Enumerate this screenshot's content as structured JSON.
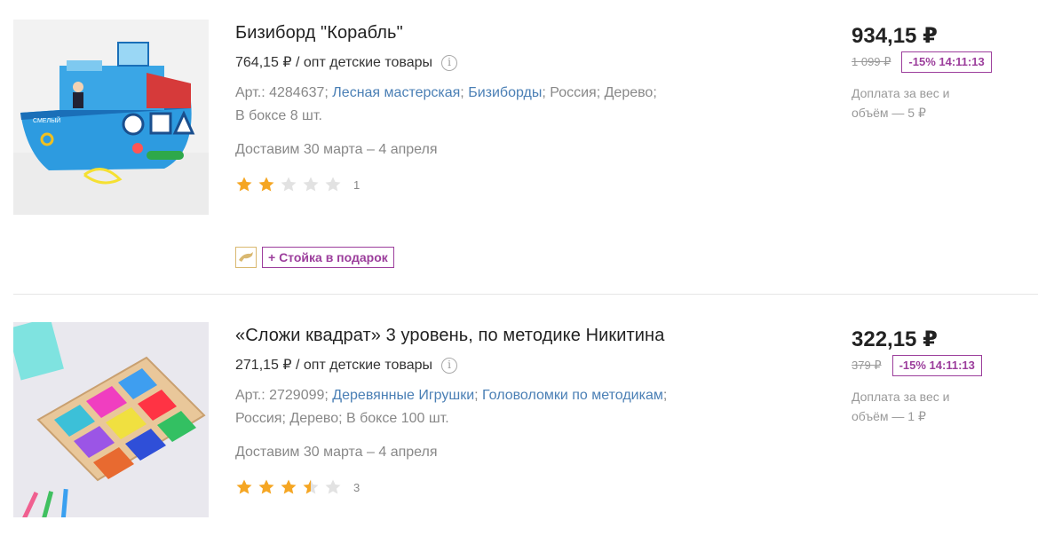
{
  "products": [
    {
      "title": "Бизиборд \"Корабль\"",
      "wholesale_price": "764,15 ₽ / опт детские товары",
      "article": "Арт.: 4284637;",
      "brand": "Лесная мастерская",
      "category": "Бизиборды",
      "attrs_line1_tail": "; Россия; Дерево;",
      "attrs_line2": "В боксе 8 шт.",
      "delivery": "Доставим 30 марта – 4 апреля",
      "rating_value": 2,
      "rating_count": "1",
      "promo_label": "+ Стойка в подарок",
      "price": "934,15 ₽",
      "old_price": "1 099 ₽",
      "discount": "-15% 14:11:13",
      "surcharge": "Доплата за вес и объём — 5 ₽",
      "image_icon": "ship-busyboard-photo"
    },
    {
      "title": "«Сложи квадрат» 3 уровень, по методике Никитина",
      "wholesale_price": "271,15 ₽ / опт детские товары",
      "article": "Арт.: 2729099;",
      "brand": "Деревянные Игрушки",
      "category": "Головоломки по методикам",
      "attrs_line2": "Россия; Дерево; В боксе 100 шт.",
      "delivery": "Доставим 30 марта – 4 апреля",
      "rating_value": 3.5,
      "rating_count": "3",
      "price": "322,15 ₽",
      "old_price": "379 ₽",
      "discount": "-15% 14:11:13",
      "surcharge": "Доплата за вес и объём — 1 ₽",
      "image_icon": "square-puzzle-photo"
    }
  ],
  "colors": {
    "link": "#4a7fb5",
    "promo": "#9c3e9c",
    "star_on": "#f5a623",
    "star_off": "#e2e2e2"
  }
}
